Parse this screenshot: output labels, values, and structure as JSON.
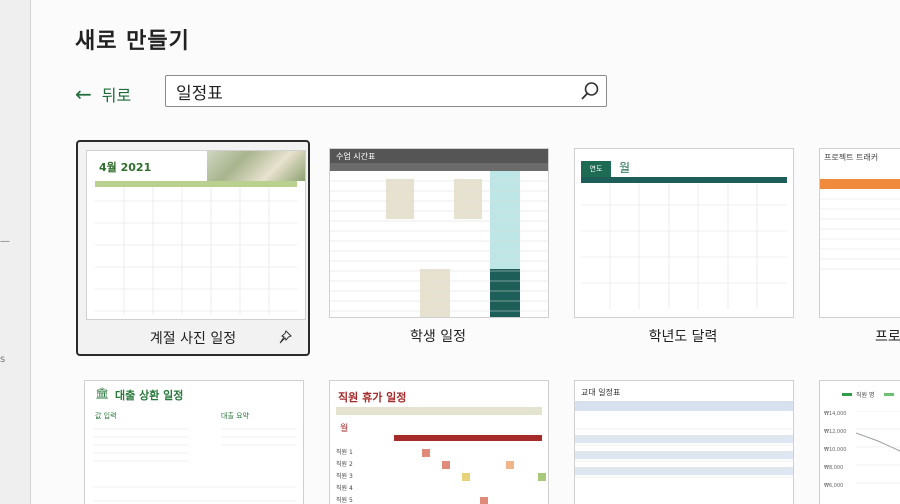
{
  "title": "새로 만들기",
  "back_label": "뒤로",
  "search": {
    "value": "일정표"
  },
  "templates_row1": [
    {
      "label": "계절 사진 일정",
      "thumb_title": "4월 2021"
    },
    {
      "label": "학생 일정",
      "thumb_title": "수업 시간표"
    },
    {
      "label": "학년도 달력",
      "thumb_title": "월",
      "thumb_year": "연도"
    },
    {
      "label": "프로",
      "thumb_title": "프로젝트 트래커"
    }
  ],
  "templates_row2": [
    {
      "thumb_title": "대출 상환 일정",
      "sub1": "값 입력",
      "sub2": "대출 요약"
    },
    {
      "thumb_title": "직원 휴가 일정",
      "month": "월",
      "employees": [
        "직원 1",
        "직원 2",
        "직원 3",
        "직원 4",
        "직원 5"
      ]
    },
    {
      "thumb_title": "교대 일정표"
    },
    {
      "legend": "직원 명",
      "axis": [
        "₩14,000",
        "₩12,000",
        "₩10,000",
        "₩8,000",
        "₩6,000",
        "₩4,000"
      ]
    }
  ],
  "colors": {
    "accent_green": "#1f6b3a",
    "teal": "#1d5e58"
  }
}
